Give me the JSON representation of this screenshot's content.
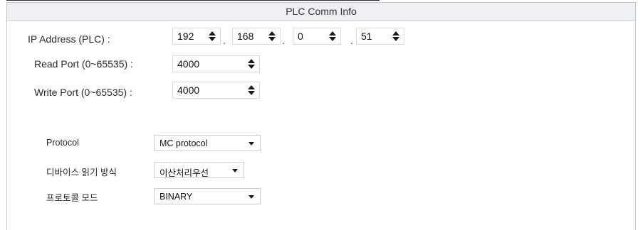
{
  "panel": {
    "title": "PLC Comm Info"
  },
  "ip": {
    "label": "IP Address (PLC) :",
    "octets": [
      "192",
      "168",
      "0",
      "51"
    ],
    "separator": "."
  },
  "read_port": {
    "label": "Read Port (0~65535) :",
    "value": "4000"
  },
  "write_port": {
    "label": "Write Port (0~65535) :",
    "value": "4000"
  },
  "protocol": {
    "label": "Protocol",
    "value": "MC protocol"
  },
  "device_read": {
    "label": "디바이스 읽기 방식",
    "value": "이산처리우선"
  },
  "protocol_mode": {
    "label": "프로토콜 모드",
    "value": "BINARY"
  },
  "colors": {
    "header_bg": "#eef0f3",
    "border": "#bfc6cf"
  }
}
